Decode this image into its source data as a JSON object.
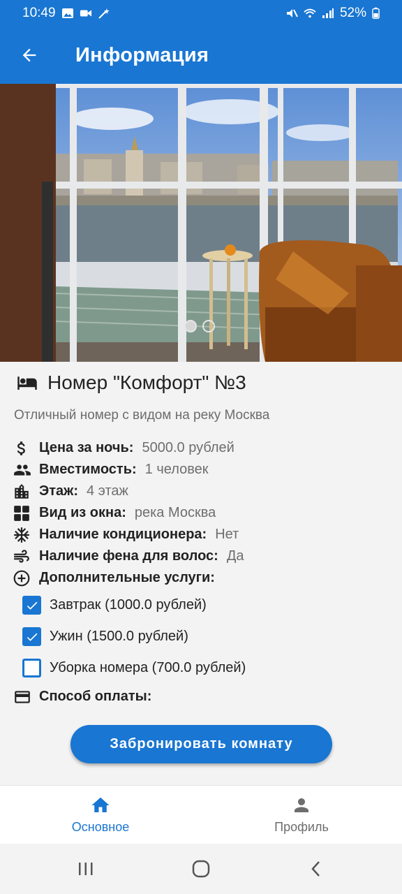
{
  "status_bar": {
    "time": "10:49",
    "battery": "52%"
  },
  "app_bar": {
    "title": "Информация"
  },
  "carousel": {
    "page_count": 2,
    "active_index": 0
  },
  "room": {
    "title": "Номер \"Комфорт\" №3",
    "description": "Отличный номер с видом на реку Москва",
    "details": [
      {
        "icon": "dollar-icon",
        "label": "Цена за ночь:",
        "value": "5000.0 рублей"
      },
      {
        "icon": "people-icon",
        "label": "Вместимость:",
        "value": "1 человек"
      },
      {
        "icon": "building-icon",
        "label": "Этаж:",
        "value": "4 этаж"
      },
      {
        "icon": "window-icon",
        "label": "Вид из окна:",
        "value": "река Москва"
      },
      {
        "icon": "snowflake-icon",
        "label": "Наличие кондиционера:",
        "value": "Нет"
      },
      {
        "icon": "wind-icon",
        "label": "Наличие фена для волос:",
        "value": "Да"
      },
      {
        "icon": "plus-circle-icon",
        "label": "Дополнительные услуги:",
        "value": ""
      }
    ],
    "services": [
      {
        "label": "Завтрак (1000.0 рублей)",
        "checked": true
      },
      {
        "label": "Ужин (1500.0 рублей)",
        "checked": true
      },
      {
        "label": "Уборка номера (700.0 рублей)",
        "checked": false
      }
    ],
    "payment_label": "Способ оплаты:"
  },
  "book_button": {
    "label": "Забронировать комнату"
  },
  "bottom_nav": {
    "items": [
      {
        "label": "Основное",
        "icon": "home-icon",
        "active": true
      },
      {
        "label": "Профиль",
        "icon": "person-icon",
        "active": false
      }
    ]
  },
  "colors": {
    "primary": "#1976d2",
    "background": "#f3f3f3"
  }
}
